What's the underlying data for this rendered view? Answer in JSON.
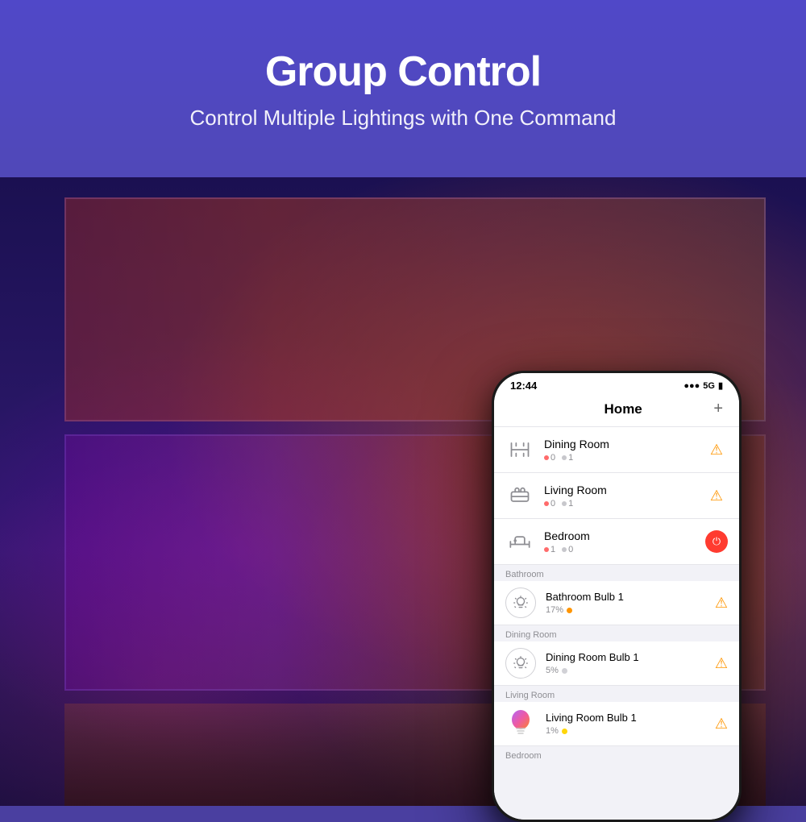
{
  "header": {
    "title": "Group Control",
    "subtitle": "Control Multiple Lightings with One Command"
  },
  "phone": {
    "status_bar": {
      "time": "12:44",
      "signal": "▌▌▌",
      "network": "5G",
      "battery": "🔋"
    },
    "app_header": {
      "title": "Home",
      "add_icon": "+"
    },
    "rooms": [
      {
        "name": "Dining Room",
        "icon": "dining-icon",
        "offline": "0",
        "online": "1",
        "action": "alert"
      },
      {
        "name": "Living Room",
        "icon": "living-room-icon",
        "offline": "0",
        "online": "1",
        "action": "alert"
      },
      {
        "name": "Bedroom",
        "icon": "bedroom-icon",
        "offline": "1",
        "online": "0",
        "action": "power"
      }
    ],
    "device_sections": [
      {
        "section": "Bathroom",
        "devices": [
          {
            "name": "Bathroom Bulb 1",
            "status_text": "17%",
            "dot_color": "orange",
            "action": "alert"
          }
        ]
      },
      {
        "section": "Dining Room",
        "devices": [
          {
            "name": "Dining Room Bulb 1",
            "status_text": "5%",
            "dot_color": "gray",
            "action": "alert"
          }
        ]
      },
      {
        "section": "Living Room",
        "devices": [
          {
            "name": "Living Room Bulb 1",
            "status_text": "1%",
            "dot_color": "yellow",
            "action": "alert"
          }
        ]
      },
      {
        "section": "Bedroom",
        "devices": []
      }
    ],
    "colors": {
      "accent_orange": "#ff9500",
      "accent_red": "#ff3b30",
      "text_primary": "#000000",
      "text_secondary": "#8e8e93",
      "bg_primary": "#ffffff",
      "bg_secondary": "#f2f2f7"
    }
  }
}
